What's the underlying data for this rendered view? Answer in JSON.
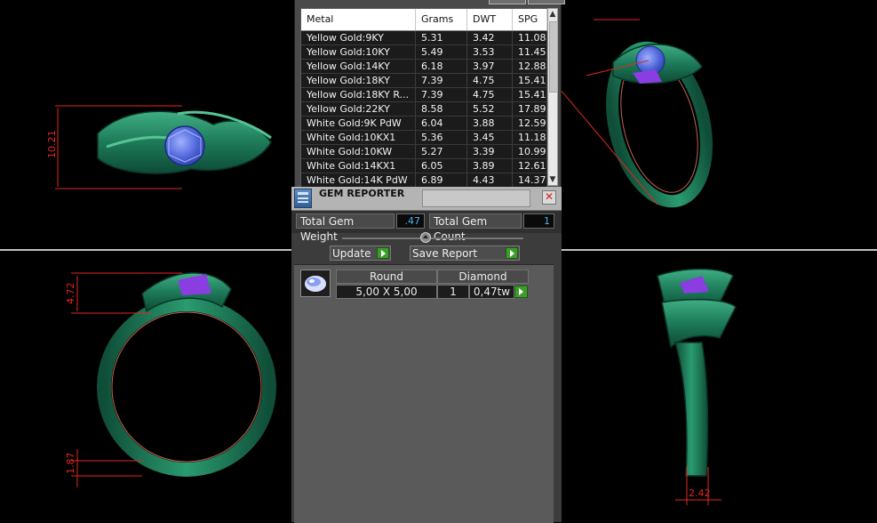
{
  "metal_table": {
    "headers": [
      "Metal",
      "Grams",
      "DWT",
      "SPG"
    ],
    "rows": [
      [
        "Yellow Gold:9KY",
        "5.31",
        "3.42",
        "11.08"
      ],
      [
        "Yellow Gold:10KY",
        "5.49",
        "3.53",
        "11.45"
      ],
      [
        "Yellow Gold:14KY",
        "6.18",
        "3.97",
        "12.88"
      ],
      [
        "Yellow Gold:18KY",
        "7.39",
        "4.75",
        "15.41"
      ],
      [
        "Yellow Gold:18KY R...",
        "7.39",
        "4.75",
        "15.41"
      ],
      [
        "Yellow Gold:22KY",
        "8.58",
        "5.52",
        "17.89"
      ],
      [
        "White Gold:9K PdW",
        "6.04",
        "3.88",
        "12.59"
      ],
      [
        "White Gold:10KX1",
        "5.36",
        "3.45",
        "11.18"
      ],
      [
        "White Gold:10KW",
        "5.27",
        "3.39",
        "10.99"
      ],
      [
        "White Gold:14KX1",
        "6.05",
        "3.89",
        "12.61"
      ],
      [
        "White Gold:14K PdW",
        "6.89",
        "4.43",
        "14.37"
      ]
    ]
  },
  "gem_reporter": {
    "title": "GEM REPORTER",
    "close_icon": "close-icon",
    "total_gem_weight_label": "Total Gem Weight",
    "total_gem_weight_value": ".47",
    "total_gem_count_label": "Total Gem Count",
    "total_gem_count_value": "1",
    "update_label": "Update",
    "save_report_label": "Save Report",
    "gem": {
      "shape": "Round",
      "type": "Diamond",
      "size": "5,00 X 5,00",
      "count": "1",
      "weight": "0,47tw"
    }
  },
  "dimensions": {
    "top_left": "10.21",
    "bottom_left_top": "4.72",
    "bottom_left_bottom": "1.87",
    "bottom_right": "2.42"
  },
  "colors": {
    "ring_green": "#1f7f5e",
    "dimension_red": "#e0281e",
    "gem_blue": "#5d78e8",
    "gem_purple": "#8a3de0",
    "accent_play": "#3f9c2c"
  }
}
